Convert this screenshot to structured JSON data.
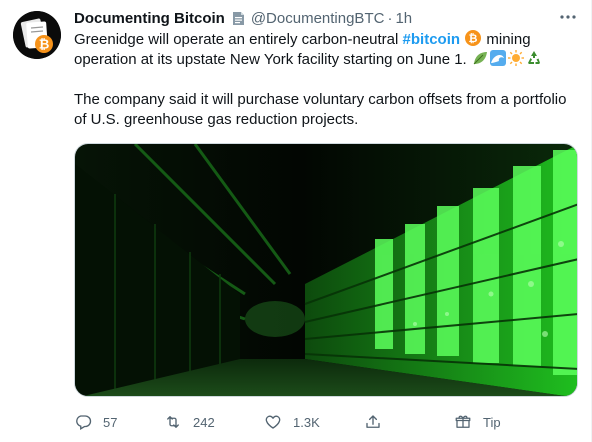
{
  "author": {
    "name": "Documenting Bitcoin",
    "handle": "@DocumentingBTC",
    "separator": "·",
    "time": "1h"
  },
  "tweet": {
    "text_before": "Greenidge will operate an entirely carbon-neutral ",
    "hashtag": "#bitcoin",
    "text_after": " mining operation at its upstate New York facility starting on June 1.",
    "paragraph2": "The company said it will purchase voluntary carbon offsets from a portfolio of U.S. greenhouse gas reduction projects.",
    "emojis": [
      "bitcoin-emoji",
      "leaf-emoji",
      "wave-emoji",
      "sun-emoji",
      "recycle-emoji"
    ]
  },
  "actions": {
    "replies": "57",
    "retweets": "242",
    "likes": "1.3K",
    "tip": "Tip"
  },
  "colors": {
    "accent": "#1d9bf0",
    "muted": "#536471",
    "bitcoin_orange": "#f7931a",
    "server_green": "#39ff3a"
  }
}
